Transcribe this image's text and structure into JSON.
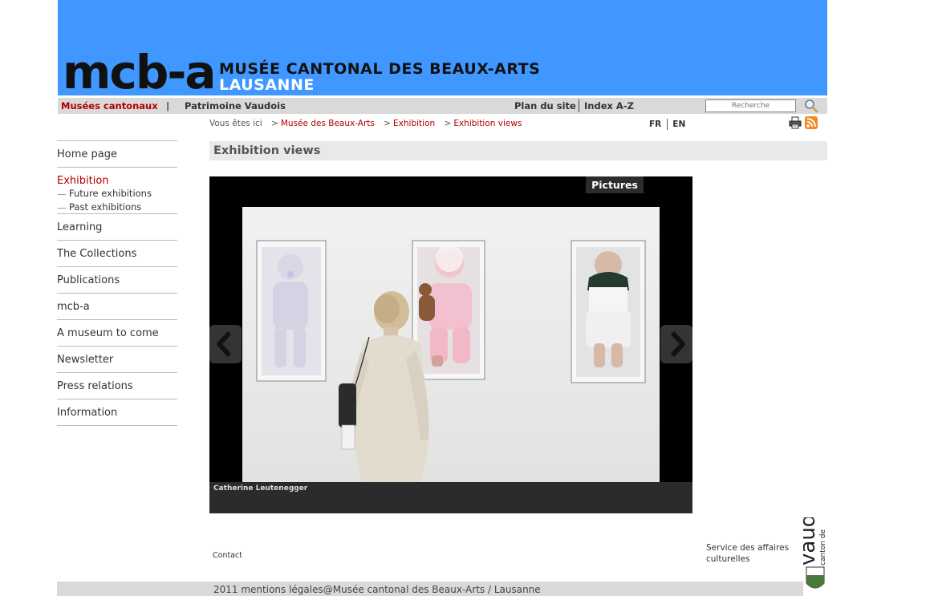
{
  "header": {
    "logo_text": "mcb-a",
    "museum_name_line1": "MUSÉE CANTONAL DES BEAUX-ARTS",
    "museum_name_line2": "LAUSANNE",
    "banner_color": "#3f97ff"
  },
  "topnav": {
    "musees": "Musées cantonaux",
    "separator": "|",
    "patrimoine": "Patrimoine Vaudois",
    "plan_du_site": "Plan du site",
    "index": "Index A-Z",
    "search_placeholder": "Recherche",
    "search_icon": "search-icon"
  },
  "breadcrumb": {
    "prefix": "Vous êtes ici",
    "items": [
      "Musée des Beaux-Arts",
      "Exhibition",
      "Exhibition views"
    ],
    "link_color": "#b30000"
  },
  "lang": {
    "fr": "FR",
    "en": "EN"
  },
  "sidebar": {
    "items": [
      {
        "label": "Home page"
      },
      {
        "label": "Exhibition"
      },
      {
        "label": "Learning"
      },
      {
        "label": "The Collections"
      },
      {
        "label": "Publications"
      },
      {
        "label": "mcb-a"
      },
      {
        "label": "A museum to come"
      },
      {
        "label": "Newsletter"
      },
      {
        "label": "Press relations"
      },
      {
        "label": "Information"
      }
    ],
    "subitems": [
      {
        "label": "Future exhibitions"
      },
      {
        "label": "Past exhibitions"
      }
    ],
    "active_color": "#b30000"
  },
  "main": {
    "title": "Exhibition views",
    "gallery": {
      "tab_label": "Pictures",
      "caption": "Catherine Leutenegger"
    }
  },
  "footer": {
    "contact": "Contact",
    "service_line1": "Service des affaires",
    "service_line2": "culturelles",
    "canton_logo_small": "canton de",
    "canton_logo_big": "vaud",
    "copyright": "2011 mentions légales@Musée cantonal des Beaux-Arts / Lausanne"
  }
}
